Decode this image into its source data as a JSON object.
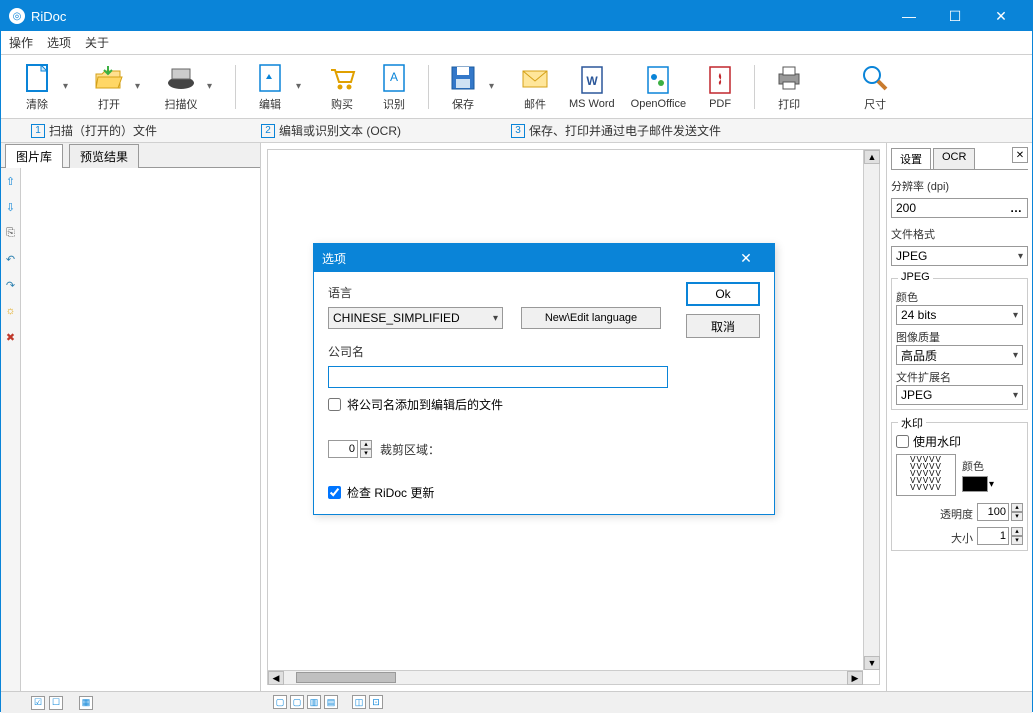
{
  "app": {
    "title": "RiDoc"
  },
  "menu": {
    "items": [
      "操作",
      "选项",
      "关于"
    ]
  },
  "toolbar": {
    "clear": "清除",
    "open": "打开",
    "scanner": "扫描仪",
    "edit": "编辑",
    "buy": "购买",
    "ocr": "识别",
    "save": "保存",
    "mail": "邮件",
    "msword": "MS Word",
    "openoffice": "OpenOffice",
    "pdf": "PDF",
    "print": "打印",
    "size": "尺寸"
  },
  "hints": {
    "h1": "扫描（打开的）文件",
    "h2": "编辑或识别文本 (OCR)",
    "h3": "保存、打印并通过电子邮件发送文件"
  },
  "left_tabs": {
    "lib": "图片库",
    "preview": "预览结果"
  },
  "right": {
    "tab_settings": "设置",
    "tab_ocr": "OCR",
    "resolution_label": "分辨率 (dpi)",
    "resolution_value": "200",
    "fileformat_label": "文件格式",
    "fileformat_value": "JPEG",
    "jpeg_group": "JPEG",
    "color_label": "颜色",
    "color_value": "24 bits",
    "quality_label": "图像质量",
    "quality_value": "高品质",
    "ext_label": "文件扩展名",
    "ext_value": "JPEG",
    "wm_group": "水印",
    "wm_use": "使用水印",
    "wm_color_label": "颜色",
    "opacity_label": "透明度",
    "opacity_value": "100",
    "size_label": "大小",
    "size_value": "1"
  },
  "dialog": {
    "title": "选项",
    "lang_label": "语言",
    "lang_value": "CHINESE_SIMPLIFIED",
    "new_lang": "New\\Edit language",
    "company_label": "公司名",
    "company_value": "",
    "append_company": "将公司名添加到编辑后的文件",
    "crop_label": "裁剪区域：",
    "crop_value": "0",
    "check_update": "检查 RiDoc 更新",
    "ok": "Ok",
    "cancel": "取消"
  }
}
